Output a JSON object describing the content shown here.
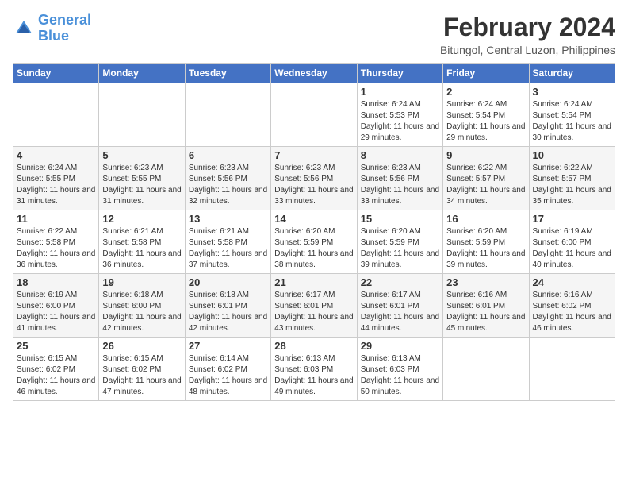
{
  "header": {
    "logo_line1": "General",
    "logo_line2": "Blue",
    "month_year": "February 2024",
    "location": "Bitungol, Central Luzon, Philippines"
  },
  "weekdays": [
    "Sunday",
    "Monday",
    "Tuesday",
    "Wednesday",
    "Thursday",
    "Friday",
    "Saturday"
  ],
  "weeks": [
    [
      {
        "day": "",
        "sunrise": "",
        "sunset": "",
        "daylight": ""
      },
      {
        "day": "",
        "sunrise": "",
        "sunset": "",
        "daylight": ""
      },
      {
        "day": "",
        "sunrise": "",
        "sunset": "",
        "daylight": ""
      },
      {
        "day": "",
        "sunrise": "",
        "sunset": "",
        "daylight": ""
      },
      {
        "day": "1",
        "sunrise": "Sunrise: 6:24 AM",
        "sunset": "Sunset: 5:53 PM",
        "daylight": "Daylight: 11 hours and 29 minutes."
      },
      {
        "day": "2",
        "sunrise": "Sunrise: 6:24 AM",
        "sunset": "Sunset: 5:54 PM",
        "daylight": "Daylight: 11 hours and 29 minutes."
      },
      {
        "day": "3",
        "sunrise": "Sunrise: 6:24 AM",
        "sunset": "Sunset: 5:54 PM",
        "daylight": "Daylight: 11 hours and 30 minutes."
      }
    ],
    [
      {
        "day": "4",
        "sunrise": "Sunrise: 6:24 AM",
        "sunset": "Sunset: 5:55 PM",
        "daylight": "Daylight: 11 hours and 31 minutes."
      },
      {
        "day": "5",
        "sunrise": "Sunrise: 6:23 AM",
        "sunset": "Sunset: 5:55 PM",
        "daylight": "Daylight: 11 hours and 31 minutes."
      },
      {
        "day": "6",
        "sunrise": "Sunrise: 6:23 AM",
        "sunset": "Sunset: 5:56 PM",
        "daylight": "Daylight: 11 hours and 32 minutes."
      },
      {
        "day": "7",
        "sunrise": "Sunrise: 6:23 AM",
        "sunset": "Sunset: 5:56 PM",
        "daylight": "Daylight: 11 hours and 33 minutes."
      },
      {
        "day": "8",
        "sunrise": "Sunrise: 6:23 AM",
        "sunset": "Sunset: 5:56 PM",
        "daylight": "Daylight: 11 hours and 33 minutes."
      },
      {
        "day": "9",
        "sunrise": "Sunrise: 6:22 AM",
        "sunset": "Sunset: 5:57 PM",
        "daylight": "Daylight: 11 hours and 34 minutes."
      },
      {
        "day": "10",
        "sunrise": "Sunrise: 6:22 AM",
        "sunset": "Sunset: 5:57 PM",
        "daylight": "Daylight: 11 hours and 35 minutes."
      }
    ],
    [
      {
        "day": "11",
        "sunrise": "Sunrise: 6:22 AM",
        "sunset": "Sunset: 5:58 PM",
        "daylight": "Daylight: 11 hours and 36 minutes."
      },
      {
        "day": "12",
        "sunrise": "Sunrise: 6:21 AM",
        "sunset": "Sunset: 5:58 PM",
        "daylight": "Daylight: 11 hours and 36 minutes."
      },
      {
        "day": "13",
        "sunrise": "Sunrise: 6:21 AM",
        "sunset": "Sunset: 5:58 PM",
        "daylight": "Daylight: 11 hours and 37 minutes."
      },
      {
        "day": "14",
        "sunrise": "Sunrise: 6:20 AM",
        "sunset": "Sunset: 5:59 PM",
        "daylight": "Daylight: 11 hours and 38 minutes."
      },
      {
        "day": "15",
        "sunrise": "Sunrise: 6:20 AM",
        "sunset": "Sunset: 5:59 PM",
        "daylight": "Daylight: 11 hours and 39 minutes."
      },
      {
        "day": "16",
        "sunrise": "Sunrise: 6:20 AM",
        "sunset": "Sunset: 5:59 PM",
        "daylight": "Daylight: 11 hours and 39 minutes."
      },
      {
        "day": "17",
        "sunrise": "Sunrise: 6:19 AM",
        "sunset": "Sunset: 6:00 PM",
        "daylight": "Daylight: 11 hours and 40 minutes."
      }
    ],
    [
      {
        "day": "18",
        "sunrise": "Sunrise: 6:19 AM",
        "sunset": "Sunset: 6:00 PM",
        "daylight": "Daylight: 11 hours and 41 minutes."
      },
      {
        "day": "19",
        "sunrise": "Sunrise: 6:18 AM",
        "sunset": "Sunset: 6:00 PM",
        "daylight": "Daylight: 11 hours and 42 minutes."
      },
      {
        "day": "20",
        "sunrise": "Sunrise: 6:18 AM",
        "sunset": "Sunset: 6:01 PM",
        "daylight": "Daylight: 11 hours and 42 minutes."
      },
      {
        "day": "21",
        "sunrise": "Sunrise: 6:17 AM",
        "sunset": "Sunset: 6:01 PM",
        "daylight": "Daylight: 11 hours and 43 minutes."
      },
      {
        "day": "22",
        "sunrise": "Sunrise: 6:17 AM",
        "sunset": "Sunset: 6:01 PM",
        "daylight": "Daylight: 11 hours and 44 minutes."
      },
      {
        "day": "23",
        "sunrise": "Sunrise: 6:16 AM",
        "sunset": "Sunset: 6:01 PM",
        "daylight": "Daylight: 11 hours and 45 minutes."
      },
      {
        "day": "24",
        "sunrise": "Sunrise: 6:16 AM",
        "sunset": "Sunset: 6:02 PM",
        "daylight": "Daylight: 11 hours and 46 minutes."
      }
    ],
    [
      {
        "day": "25",
        "sunrise": "Sunrise: 6:15 AM",
        "sunset": "Sunset: 6:02 PM",
        "daylight": "Daylight: 11 hours and 46 minutes."
      },
      {
        "day": "26",
        "sunrise": "Sunrise: 6:15 AM",
        "sunset": "Sunset: 6:02 PM",
        "daylight": "Daylight: 11 hours and 47 minutes."
      },
      {
        "day": "27",
        "sunrise": "Sunrise: 6:14 AM",
        "sunset": "Sunset: 6:02 PM",
        "daylight": "Daylight: 11 hours and 48 minutes."
      },
      {
        "day": "28",
        "sunrise": "Sunrise: 6:13 AM",
        "sunset": "Sunset: 6:03 PM",
        "daylight": "Daylight: 11 hours and 49 minutes."
      },
      {
        "day": "29",
        "sunrise": "Sunrise: 6:13 AM",
        "sunset": "Sunset: 6:03 PM",
        "daylight": "Daylight: 11 hours and 50 minutes."
      },
      {
        "day": "",
        "sunrise": "",
        "sunset": "",
        "daylight": ""
      },
      {
        "day": "",
        "sunrise": "",
        "sunset": "",
        "daylight": ""
      }
    ]
  ]
}
